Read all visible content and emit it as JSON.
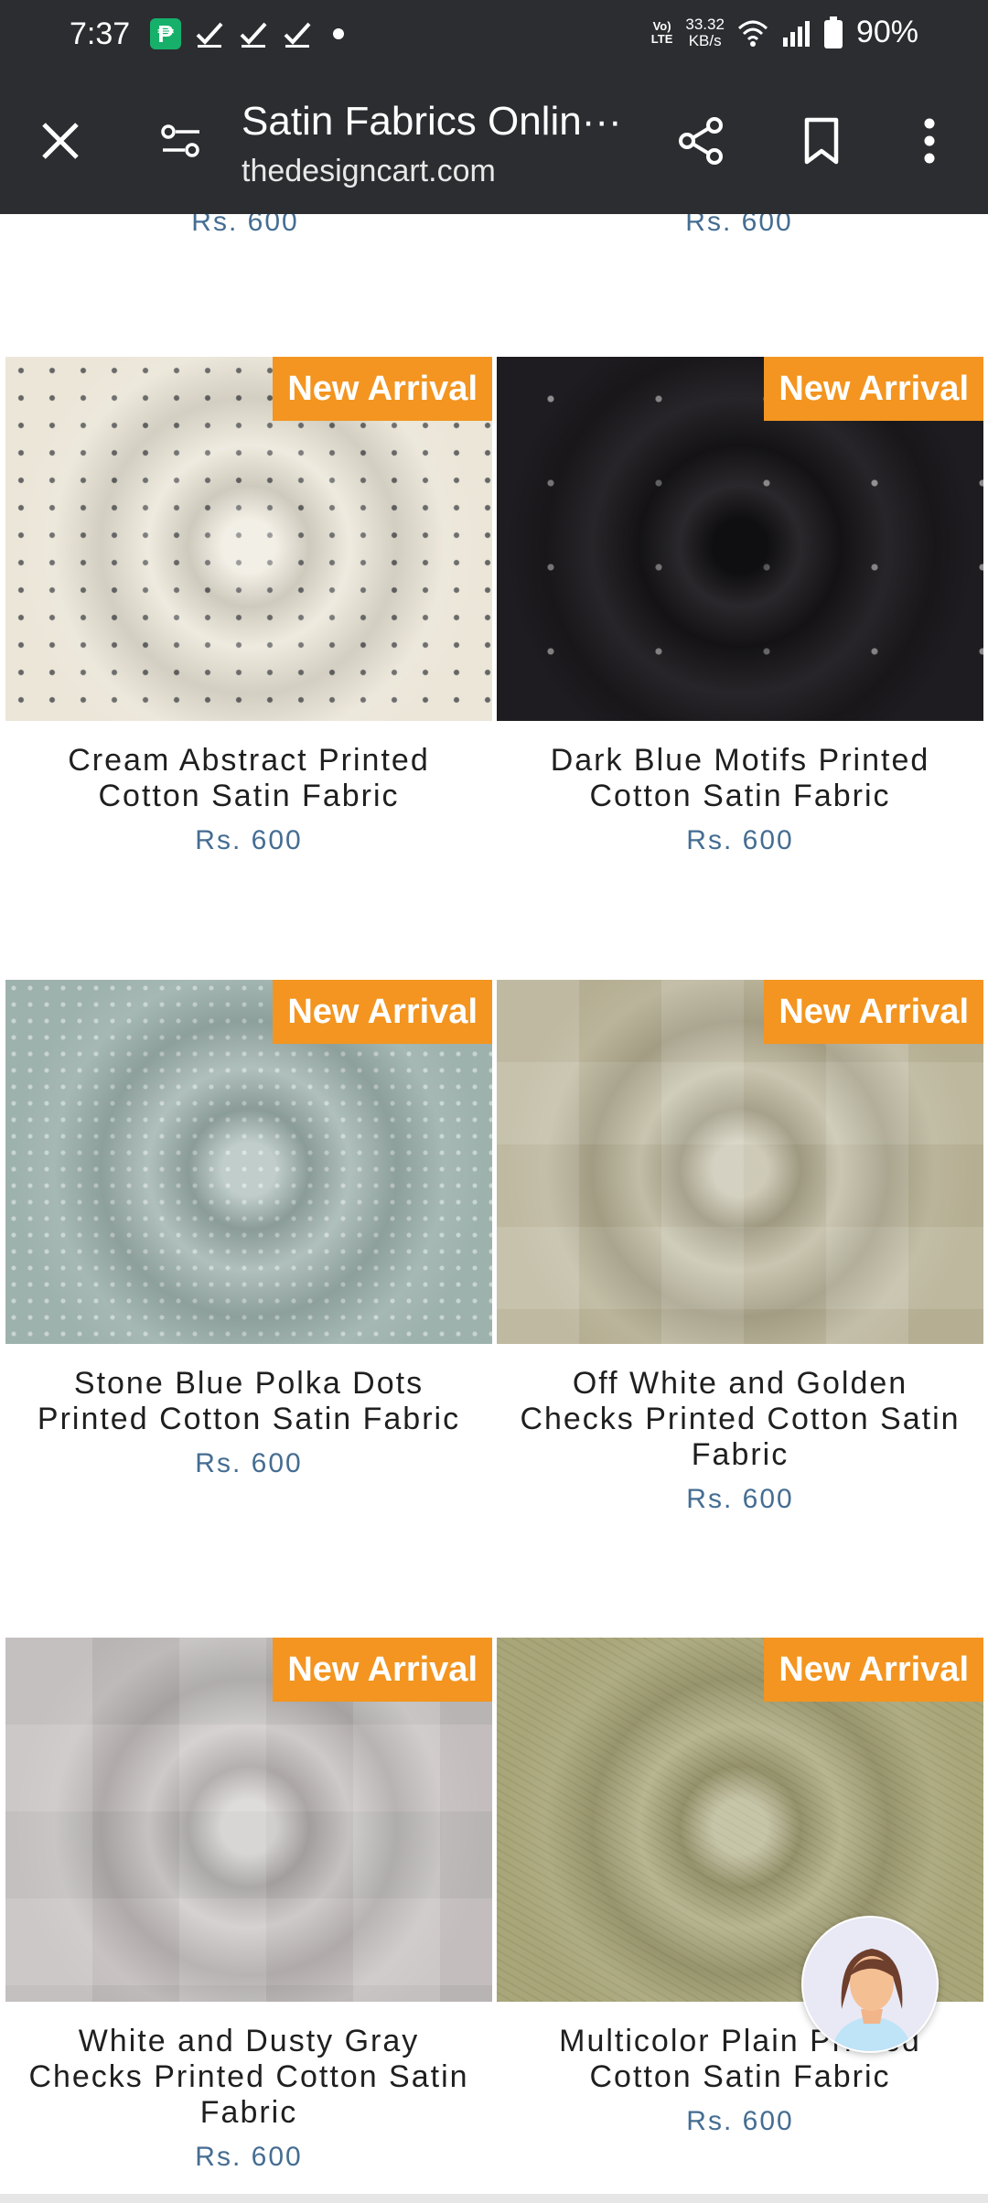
{
  "status_bar": {
    "time": "7:37",
    "app_badge": "₱",
    "volte": "Vo)\nLTE",
    "net_speed": "33.32\nKB/s",
    "battery": "90%"
  },
  "toolbar": {
    "title": "Satin Fabrics Onlin···",
    "domain": "thedesigncart.com"
  },
  "previous_row": {
    "left_price": "Rs. 600",
    "right_price": "Rs. 600"
  },
  "products": [
    {
      "badge": "New Arrival",
      "name": "Cream Abstract Printed Cotton Satin Fabric",
      "price": "Rs. 600"
    },
    {
      "badge": "New Arrival",
      "name": "Dark Blue Motifs Printed Cotton Satin Fabric",
      "price": "Rs. 600"
    },
    {
      "badge": "New Arrival",
      "name": "Stone Blue Polka Dots Printed Cotton Satin Fabric",
      "price": "Rs. 600"
    },
    {
      "badge": "New Arrival",
      "name": "Off White and Golden Checks Printed Cotton Satin Fabric",
      "price": "Rs. 600"
    },
    {
      "badge": "New Arrival",
      "name": "White and Dusty Gray Checks Printed Cotton Satin Fabric",
      "price": "Rs. 600"
    },
    {
      "badge": "New Arrival",
      "name": "Multicolor Plain Printed Cotton Satin Fabric",
      "price": "Rs. 600"
    }
  ],
  "icons": {
    "close": "close-icon",
    "page_info": "tune-icon",
    "share": "share-icon",
    "bookmark": "bookmark-icon",
    "menu": "more-vert-icon",
    "chat": "chat-assistant-avatar"
  },
  "colors": {
    "toolbar_bg": "#2c2d31",
    "badge_bg": "#f39520",
    "price_text": "#456d92"
  }
}
